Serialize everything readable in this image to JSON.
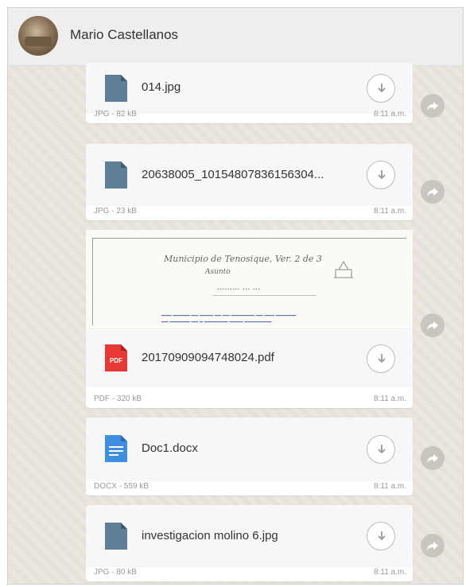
{
  "header": {
    "contact_name": "Mario Castellanos"
  },
  "messages": [
    {
      "name": "014.jpg",
      "type": "JPG - 82 kB",
      "time": "8:11 a.m.",
      "icon": "document-icon",
      "color": "#5e7f95"
    },
    {
      "name": "20638005_10154807836156304...",
      "type": "JPG - 23 kB",
      "time": "8:11 a.m.",
      "icon": "document-icon",
      "color": "#5e7f95"
    },
    {
      "name": "20170909094748024.pdf",
      "type": "PDF - 320 kB",
      "time": "8:11 a.m.",
      "icon": "pdf-icon",
      "color": "#e53935",
      "icon_label": "PDF"
    },
    {
      "name": "Doc1.docx",
      "type": "DOCX - 559 kB",
      "time": "8:11 a.m.",
      "icon": "word-document-icon",
      "color": "#3f8ee0"
    },
    {
      "name": "investigacion molino 6.jpg",
      "type": "JPG - 80 kB",
      "time": "8:11 a.m.",
      "icon": "document-icon",
      "color": "#5e7f95"
    }
  ],
  "colors": {
    "chat_background": "#e8e4dd",
    "bubble": "#ffffff",
    "header": "#eeeeee"
  }
}
